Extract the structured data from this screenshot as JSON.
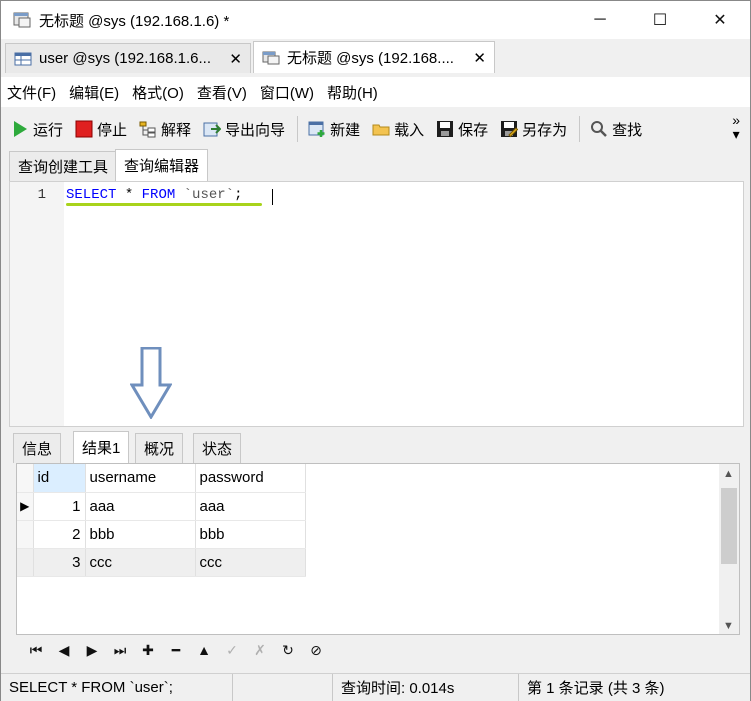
{
  "window": {
    "title": "无标题 @sys (192.168.1.6) *",
    "minimize": "─",
    "maximize": "☐",
    "close": "✕"
  },
  "doc_tabs": [
    {
      "label": "user @sys (192.168.1.6...",
      "close": "✕"
    },
    {
      "label": "无标题 @sys (192.168....",
      "close": "✕"
    }
  ],
  "menu": [
    "文件(F)",
    "编辑(E)",
    "格式(O)",
    "查看(V)",
    "窗口(W)",
    "帮助(H)"
  ],
  "toolbar": {
    "run": "运行",
    "stop": "停止",
    "explain": "解释",
    "export_wizard": "导出向导",
    "new": "新建",
    "load": "载入",
    "save": "保存",
    "save_as": "另存为",
    "find": "查找",
    "more": "»"
  },
  "editor_tabs": [
    "查询创建工具",
    "查询编辑器"
  ],
  "editor": {
    "line_number": "1",
    "kw_select": "SELECT",
    "star": " * ",
    "kw_from": "FROM",
    "table": " `user`",
    "semicolon": ";"
  },
  "result_tabs": [
    "信息",
    "结果1",
    "概况",
    "状态"
  ],
  "grid": {
    "columns": [
      "id",
      "username",
      "password"
    ],
    "rows": [
      {
        "id": "1",
        "username": "aaa",
        "password": "aaa"
      },
      {
        "id": "2",
        "username": "bbb",
        "password": "bbb"
      },
      {
        "id": "3",
        "username": "ccc",
        "password": "ccc"
      }
    ],
    "row_marker": "▶"
  },
  "navigator": [
    "⏮",
    "◀",
    "▶",
    "⏭",
    "✚",
    "━",
    "▲",
    "✓",
    "✗",
    "↻",
    "⊘"
  ],
  "status": {
    "sql": "SELECT * FROM `user`;",
    "query_time": "查询时间: 0.014s",
    "record": "第 1 条记录 (共 3 条)"
  },
  "colors": {
    "keyword": "#0000ff",
    "underline": "#a8d31b",
    "arrow": "#6f8fbd"
  }
}
